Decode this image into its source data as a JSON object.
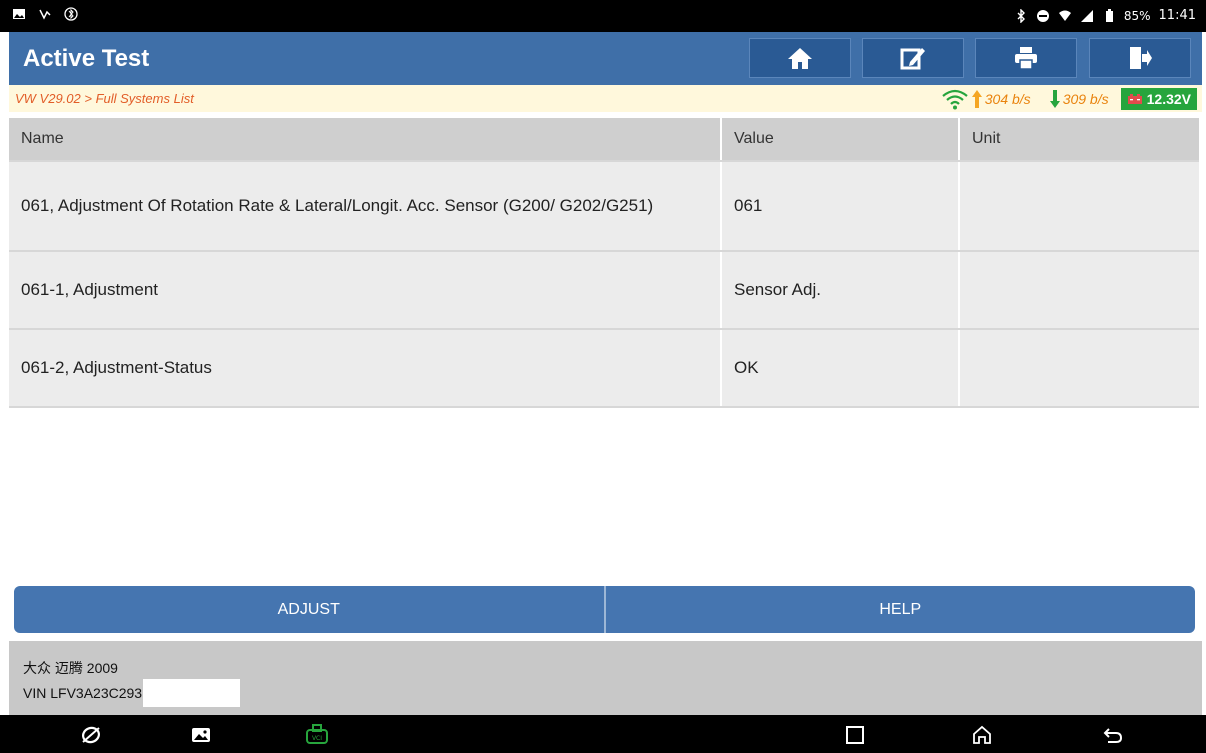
{
  "status_bar": {
    "battery_percent": "85%",
    "time": "11:41"
  },
  "header": {
    "title": "Active Test",
    "buttons": [
      {
        "icon": "home-icon"
      },
      {
        "icon": "edit-icon"
      },
      {
        "icon": "print-icon"
      },
      {
        "icon": "exit-icon"
      }
    ]
  },
  "breadcrumb": {
    "text": "VW V29.02 > Full Systems List",
    "upload_rate": "304 b/s",
    "download_rate": "309 b/s",
    "voltage": "12.32V"
  },
  "table": {
    "headers": [
      "Name",
      "Value",
      "Unit"
    ],
    "rows": [
      {
        "name": "061, Adjustment Of Rotation Rate & Lateral/Longit. Acc. Sensor (G200/ G202/G251)",
        "value": "061",
        "unit": ""
      },
      {
        "name": "061-1, Adjustment",
        "value": "Sensor Adj.",
        "unit": ""
      },
      {
        "name": "061-2, Adjustment-Status",
        "value": "OK",
        "unit": ""
      }
    ]
  },
  "actions": {
    "adjust_label": "ADJUST",
    "help_label": "HELP"
  },
  "footer": {
    "vehicle": "大众 迈腾 2009",
    "vin": "VIN LFV3A23C293"
  },
  "colors": {
    "header_blue": "#3f6fa8",
    "breadcrumb_text": "#e25d28",
    "battery_green": "#27a53d"
  }
}
